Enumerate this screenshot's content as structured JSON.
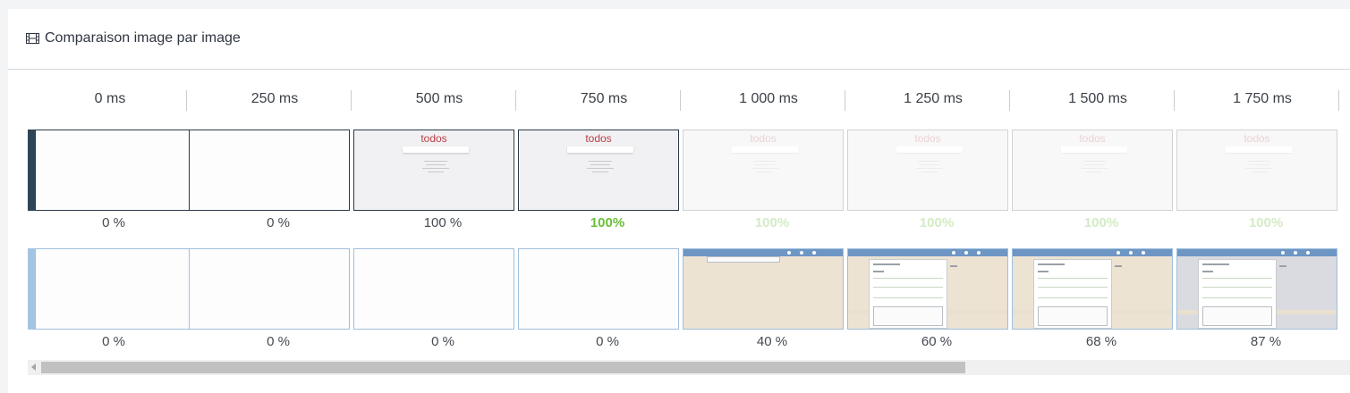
{
  "panel": {
    "title": "Comparaison image par image",
    "icon": "film-icon"
  },
  "timeline": {
    "ticks": [
      "0 ms",
      "250 ms",
      "500 ms",
      "750 ms",
      "1 000 ms",
      "1 250 ms",
      "1 500 ms",
      "1 750 ms"
    ]
  },
  "rows": [
    {
      "marker_color": "#2e4457",
      "frames": [
        {
          "content": "blank",
          "progress": "0 %"
        },
        {
          "content": "blank",
          "progress": "0 %"
        },
        {
          "content": "todos",
          "title": "todos",
          "progress": "100 %"
        },
        {
          "content": "todos",
          "title": "todos",
          "progress": "100%"
        },
        {
          "content": "todos-faded",
          "title": "todos",
          "progress": "100%"
        },
        {
          "content": "todos-faded",
          "title": "todos",
          "progress": "100%"
        },
        {
          "content": "todos-faded",
          "title": "todos",
          "progress": "100%"
        },
        {
          "content": "todos-faded",
          "title": "todos",
          "progress": "100%"
        }
      ]
    },
    {
      "marker_color": "#a4c4e4",
      "frames": [
        {
          "content": "blank",
          "progress": "0 %"
        },
        {
          "content": "blank",
          "progress": "0 %"
        },
        {
          "content": "blank",
          "progress": "0 %"
        },
        {
          "content": "blank",
          "progress": "0 %"
        },
        {
          "content": "app-loading",
          "progress": "40 %"
        },
        {
          "content": "app",
          "progress": "60 %"
        },
        {
          "content": "app",
          "progress": "68 %"
        },
        {
          "content": "app-grey",
          "progress": "87 %"
        }
      ]
    }
  ],
  "colors": {
    "highlight_green": "#6abf3a",
    "todos_red": "#b83f45",
    "app_header_blue": "#6e96c4"
  }
}
